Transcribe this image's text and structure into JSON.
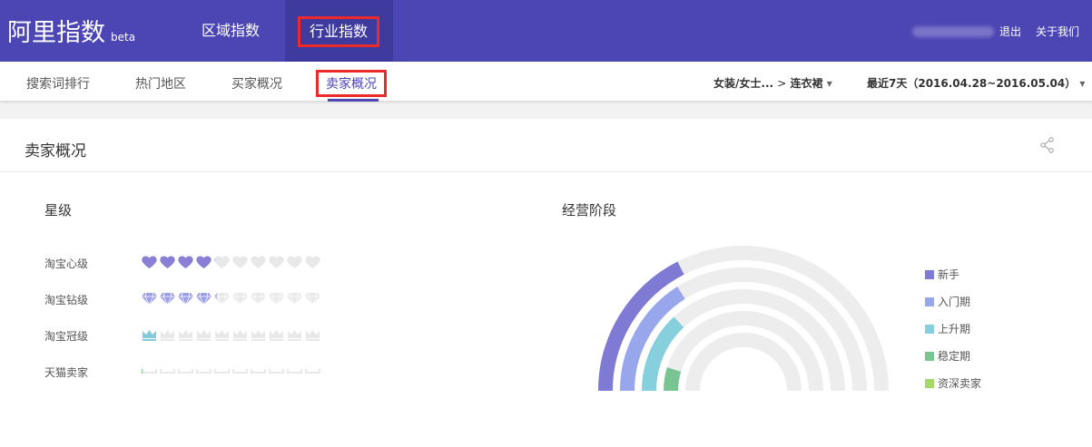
{
  "header": {
    "logo": "阿里指数",
    "beta": "beta",
    "nav": [
      "区域指数",
      "行业指数"
    ],
    "logout": "退出",
    "about": "关于我们"
  },
  "subnav": {
    "tabs": [
      "搜索词排行",
      "热门地区",
      "买家概况",
      "卖家概况"
    ],
    "category": "女装/女士...",
    "category_sep": ">",
    "subcategory": "连衣裙",
    "date_range": "最近7天（2016.04.28~2016.05.04）"
  },
  "card": {
    "title": "卖家概况"
  },
  "star": {
    "title": "星级",
    "rows": [
      {
        "label": "淘宝心级",
        "icon": "heart",
        "filled": 4.1,
        "max": 10,
        "color": "#8a7fd6"
      },
      {
        "label": "淘宝钻级",
        "icon": "diamond",
        "filled": 4.2,
        "max": 10,
        "color": "#9b9fe8"
      },
      {
        "label": "淘宝冠级",
        "icon": "crown",
        "filled": 1.1,
        "max": 10,
        "color": "#86c9dc"
      },
      {
        "label": "天猫卖家",
        "icon": "tmall",
        "filled": 0.1,
        "max": 10,
        "color": "#7cc48e"
      }
    ]
  },
  "chart_data": {
    "type": "radial-bar",
    "title": "经营阶段",
    "categories": [
      "新手",
      "入门期",
      "上升期",
      "稳定期",
      "资深卖家"
    ],
    "values": [
      0.35,
      0.32,
      0.26,
      0.095,
      0.0
    ],
    "colors": [
      "#7f7ad4",
      "#98a6ec",
      "#86cfdc",
      "#78c493",
      "#a5d86a"
    ],
    "legend": "right"
  }
}
